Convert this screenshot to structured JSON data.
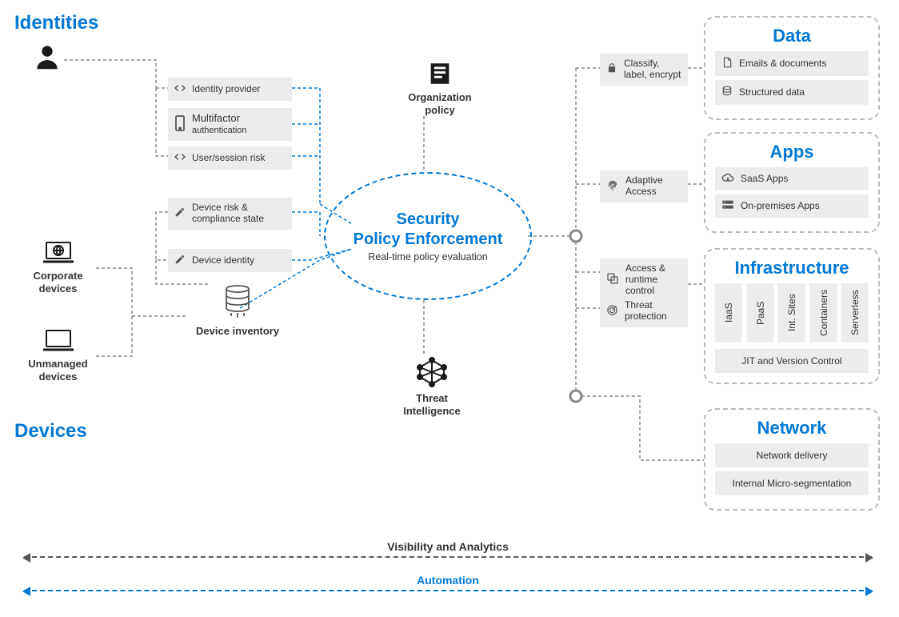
{
  "sections": {
    "identities": "Identities",
    "devices": "Devices"
  },
  "identity_nodes": {
    "provider": "Identity  provider",
    "mfa_title": "Multifactor",
    "mfa_sub": "authentication",
    "risk": "User/session risk"
  },
  "device_nodes": {
    "risk_title": "Device  risk &",
    "risk_sub": "compliance  state",
    "identity": "Device  identity",
    "inventory": "Device inventory",
    "corporate": "Corporate devices",
    "unmanaged": "Unmanaged devices"
  },
  "center": {
    "org_policy": "Organization policy",
    "title_l1": "Security",
    "title_l2": "Policy  Enforcement",
    "sub": "Real-time policy evaluation",
    "threat": "Threat Intelligence"
  },
  "mid_nodes": {
    "classify": "Classify, label, encrypt",
    "adaptive": "Adaptive Access",
    "access_runtime": "Access & runtime control",
    "threat_protection": "Threat protection"
  },
  "groups": {
    "data": {
      "title": "Data",
      "items": [
        "Emails & documents",
        "Structured data"
      ]
    },
    "apps": {
      "title": "Apps",
      "items": [
        "SaaS Apps",
        "On-premises Apps"
      ]
    },
    "infra": {
      "title": "Infrastructure",
      "cells": [
        "IaaS",
        "PaaS",
        "Int. Sites",
        "Containers",
        "Serverless"
      ],
      "wide": "JIT and Version Control"
    },
    "network": {
      "title": "Network",
      "items": [
        "Network delivery",
        "Internal Micro-segmentation"
      ]
    }
  },
  "bottom": {
    "visibility": "Visibility and Analytics",
    "automation": "Automation"
  }
}
